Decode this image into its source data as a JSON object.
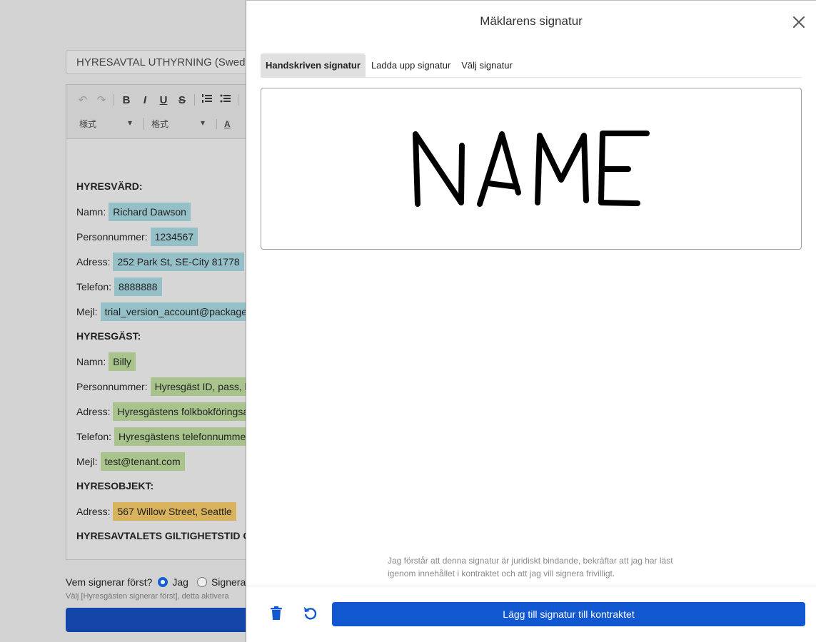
{
  "background": {
    "doc_title_value": "HYRESAVTAL UTHYRNING (Sweden",
    "toolbar": {
      "undo": "↶",
      "redo": "↷",
      "bold": "B",
      "italic": "I",
      "underline": "U",
      "strike": "S",
      "style_dropdown": "様式",
      "format_dropdown": "格式",
      "font_color": "A"
    },
    "sections": {
      "landlord": "HYRESVÄRD:",
      "tenant": "HYRESGÄST:",
      "object": "HYRESOBJEKT:",
      "period": "HYRESAVTALETS GILTIGHETSTID OC"
    },
    "landlord_fields": [
      {
        "label": "Namn:",
        "value": "Richard Dawson"
      },
      {
        "label": "Personnummer:",
        "value": "1234567"
      },
      {
        "label": "Adress:",
        "value": "252 Park St, SE-City 81778"
      },
      {
        "label": "Telefon:",
        "value": "8888888"
      },
      {
        "label": "Mejl:",
        "value": "trial_version_account@packager"
      }
    ],
    "tenant_fields": [
      {
        "label": "Namn:",
        "value": "Billy"
      },
      {
        "label": "Personnummer:",
        "value": "Hyresgäst ID, pass, kö"
      },
      {
        "label": "Adress:",
        "value": "Hyresgästens folkbokföringsad"
      },
      {
        "label": "Telefon:",
        "value": "Hyresgästens telefonnummer"
      },
      {
        "label": "Mejl:",
        "value": "test@tenant.com"
      }
    ],
    "object_fields": [
      {
        "label": "Adress:",
        "value": "567 Willow Street, Seattle"
      }
    ],
    "signer": {
      "question": "Vem signerar först?",
      "option_me": "Jag",
      "option_other": "Signera",
      "hint": "Välj [Hyresgästen signerar först], detta aktivera"
    }
  },
  "modal": {
    "title": "Mäklarens signatur",
    "tabs": [
      "Handskriven signatur",
      "Ladda upp signatur",
      "Välj signatur"
    ],
    "active_tab": "Handskriven signatur",
    "signature_text_drawn": "NAME",
    "legal_text": "Jag förstår att denna signatur är juridiskt bindande, bekräftar att jag har läst igenom innehållet i kontraktet och att jag vill signera frivilligt.",
    "add_button": "Lägg till signatur till kontraktet",
    "icons": {
      "delete": "trash-icon",
      "reset": "undo-icon",
      "close": "close-icon"
    },
    "accent_color": "#1157d0"
  }
}
